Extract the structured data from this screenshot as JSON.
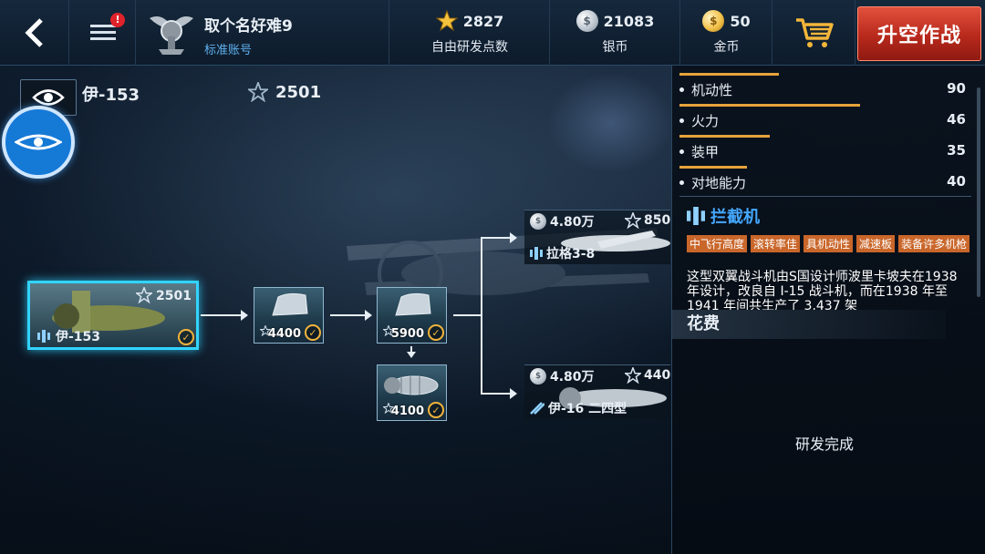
{
  "topbar": {
    "notification_count": "!",
    "player": {
      "name": "取个名好难9",
      "account_type": "标准账号"
    },
    "resources": [
      {
        "key": "research",
        "value": "2827",
        "label": "自由研发点数",
        "icon": "star-icon"
      },
      {
        "key": "silver",
        "value": "21083",
        "label": "银币",
        "icon": "silver-coin-icon"
      },
      {
        "key": "gold",
        "value": "50",
        "label": "金币",
        "icon": "gold-coin-icon"
      }
    ],
    "takeoff_label": "升空作战"
  },
  "aircraft": {
    "name": "伊-153",
    "research_points": "2501"
  },
  "tree": {
    "selected": {
      "name": "伊-153",
      "points": "2501"
    },
    "modules": [
      {
        "cost": "4400"
      },
      {
        "cost": "5900"
      },
      {
        "cost": "4100"
      }
    ],
    "unlocks": [
      {
        "silver_cost": "4.80万",
        "points": "850",
        "name": "拉格3-8"
      },
      {
        "silver_cost": "4.80万",
        "points": "440",
        "name": "伊-16 二四型"
      }
    ]
  },
  "panel": {
    "stats": [
      {
        "label": "机动性",
        "value": "90",
        "fill": 0.34
      },
      {
        "label": "火力",
        "value": "46",
        "fill": 0.62
      },
      {
        "label": "装甲",
        "value": "35",
        "fill": 0.31
      },
      {
        "label": "对地能力",
        "value": "40",
        "fill": 0.23
      }
    ],
    "role": "拦截机",
    "tags": [
      "中飞行高度",
      "滚转率佳",
      "具机动性",
      "减速板",
      "装备许多机枪"
    ],
    "description": "这型双翼战斗机由S国设计师波里卡坡夫在1938 年设计，改良自 I-15 战斗机，而在1938 年至 1941 年间共生产了 3,437 架",
    "cost_header": "花费",
    "status": "研发完成"
  },
  "colors": {
    "accent_blue": "#32d4ff",
    "stat_bar": "#e7a33b",
    "role_blue": "#45a8ff",
    "tag_orange": "#c9662a",
    "takeoff_red": "#c0301f"
  }
}
